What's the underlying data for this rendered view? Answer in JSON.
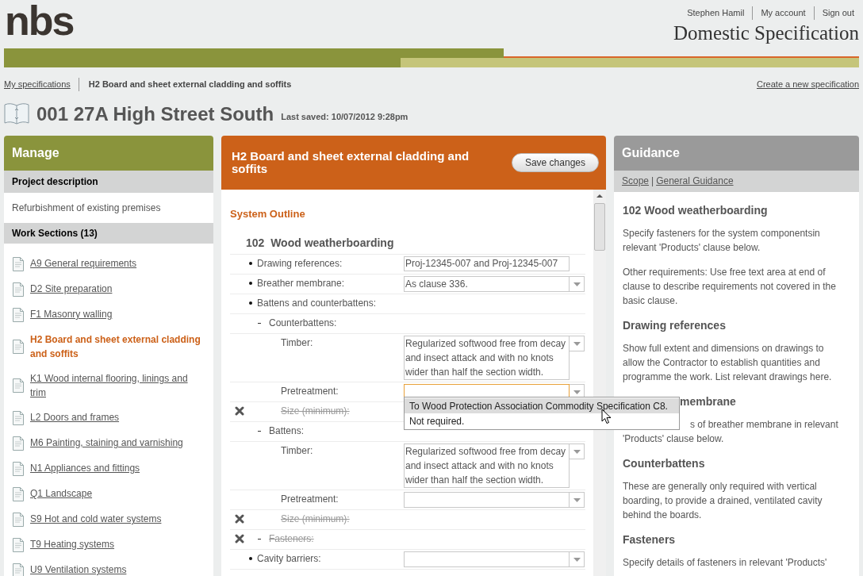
{
  "logo": "nbs",
  "user_menu": [
    "Stephen Hamil",
    "My account",
    "Sign out"
  ],
  "app_title": "Domestic Specification",
  "breadcrumb": {
    "link": "My specifications",
    "current": "H2 Board and sheet external cladding and soffits"
  },
  "create_link": "Create a new specification",
  "project": {
    "title": "001 27A High Street South",
    "last_saved": "Last saved: 10/07/2012 9:28pm"
  },
  "manage": {
    "title": "Manage",
    "project_description_heading": "Project description",
    "project_description": "Refurbishment of existing premises",
    "work_sections_heading": "Work Sections (13)",
    "sections": [
      {
        "label": "A9 General requirements",
        "selected": false
      },
      {
        "label": "D2 Site preparation",
        "selected": false
      },
      {
        "label": "F1 Masonry walling",
        "selected": false
      },
      {
        "label": "H2 Board and sheet external cladding and soffits",
        "selected": true
      },
      {
        "label": "K1 Wood internal flooring, linings and trim",
        "selected": false
      },
      {
        "label": "L2 Doors and frames",
        "selected": false
      },
      {
        "label": "M6 Painting, staining and varnishing",
        "selected": false
      },
      {
        "label": "N1 Appliances and fittings",
        "selected": false
      },
      {
        "label": "Q1 Landscape",
        "selected": false
      },
      {
        "label": "S9 Hot and cold water systems",
        "selected": false
      },
      {
        "label": "T9 Heating systems",
        "selected": false
      },
      {
        "label": "U9 Ventilation systems",
        "selected": false
      }
    ]
  },
  "editor": {
    "title": "H2 Board and sheet external cladding and soffits",
    "save_button": "Save changes",
    "section_title": "System Outline",
    "clause": "102  Wood weatherboarding",
    "items": [
      {
        "label": "Drawing references:",
        "struck": false,
        "field": {
          "kind": "text",
          "value": "Proj-12345-007 and  Proj-12345-007",
          "focused": false
        }
      },
      {
        "label": "Breather membrane:",
        "struck": false,
        "field": {
          "kind": "select",
          "value": "As clause 336.",
          "focused": false
        }
      },
      {
        "label": "Battens and counterbattens:",
        "struck": false,
        "children": [
          {
            "label": "Counterbattens:",
            "struck": false,
            "children": [
              {
                "label": "Timber:",
                "struck": false,
                "field": {
                  "kind": "select",
                  "value": "Regularized softwood free from decay and insect attack and with no knots wider than half the section width.",
                  "focused": false
                }
              },
              {
                "label": "Pretreatment:",
                "struck": false,
                "field": {
                  "kind": "select",
                  "focused": true
                }
              },
              {
                "label": "Size (minimum):",
                "struck": true
              }
            ]
          },
          {
            "label": "Battens:",
            "struck": false,
            "children": [
              {
                "label": "Timber:",
                "struck": false,
                "field": {
                  "kind": "select",
                  "value": "Regularized softwood free from decay and insect attack and with no knots wider than half the section width.",
                  "focused": false
                }
              },
              {
                "label": "Pretreatment:",
                "struck": false,
                "field": {
                  "kind": "select",
                  "focused": false
                }
              },
              {
                "label": "Size (minimum):",
                "struck": true
              }
            ]
          },
          {
            "label": "Fasteners:",
            "struck": true
          }
        ]
      },
      {
        "label": "Cavity barriers:",
        "struck": false,
        "field": {
          "kind": "select",
          "focused": false
        }
      }
    ],
    "dropdown": [
      {
        "label": "To Wood Protection Association Commodity Specification C8.",
        "selected": true
      },
      {
        "label": "Not required.",
        "selected": false
      }
    ]
  },
  "guidance": {
    "title": "Guidance",
    "links": [
      "Scope",
      "General Guidance"
    ],
    "separator": "|",
    "blocks": [
      {
        "kind": "heading",
        "text": "102 Wood weatherboarding"
      },
      {
        "kind": "paragraph",
        "text": "Specify fasteners for the system componentsin relevant 'Products' clause below."
      },
      {
        "kind": "paragraph",
        "text": "Other requirements: Use free text area at end of clause to describe requirements not covered in the basic clause."
      },
      {
        "kind": "heading",
        "text": "Drawing references"
      },
      {
        "kind": "paragraph",
        "text": "Show full extent and dimensions on drawings to allow the Contractor to establish quantities and programme the work. List relevant drawings here."
      },
      {
        "kind": "heading-partial",
        "text": "membrane"
      },
      {
        "kind": "paragraph-partial",
        "text": "s of breather membrane in relevant 'Products' clause below."
      },
      {
        "kind": "heading",
        "text": "Counterbattens"
      },
      {
        "kind": "paragraph",
        "text": "These are generally only required with vertical boarding, to provide a drained, ventilated cavity behind the boards."
      },
      {
        "kind": "heading",
        "text": "Fasteners"
      },
      {
        "kind": "paragraph",
        "text": "Specify details of fasteners in relevant 'Products'"
      }
    ]
  }
}
